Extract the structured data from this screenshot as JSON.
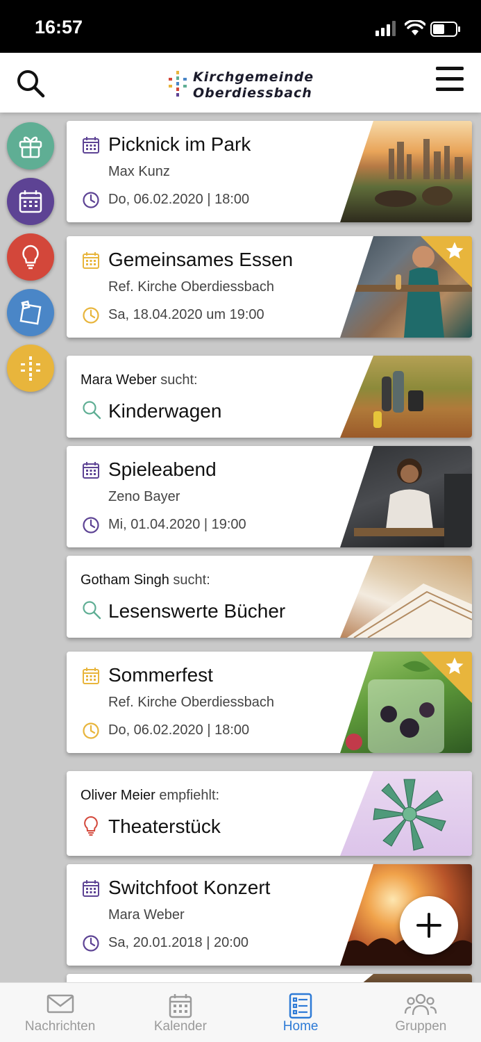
{
  "status_bar": {
    "time": "16:57"
  },
  "header": {
    "logo_line1": "Kirchgemeinde",
    "logo_line2": "Oberdiessbach"
  },
  "side_menu": [
    {
      "icon": "gift-icon",
      "color": "#5fae94"
    },
    {
      "icon": "calendar-icon",
      "color": "#5d4394"
    },
    {
      "icon": "lightbulb-icon",
      "color": "#d3473a"
    },
    {
      "icon": "note-icon",
      "color": "#4a86c7"
    },
    {
      "icon": "cross-icon",
      "color": "#e8b53c"
    }
  ],
  "feed": [
    {
      "type": "event",
      "title": "Picknick im Park",
      "subtitle": "Max Kunz",
      "datetime": "Do, 06.02.2020 | 18:00",
      "accent": "#5d4394",
      "featured": false
    },
    {
      "type": "event",
      "title": "Gemeinsames Essen",
      "subtitle": "Ref. Kirche Oberdiessbach",
      "datetime": "Sa, 18.04.2020 um 19:00",
      "accent": "#e8b53c",
      "featured": true
    },
    {
      "type": "search",
      "person": "Mara Weber",
      "verb": "sucht:",
      "title": "Kinderwagen",
      "accent": "#5fae94"
    },
    {
      "type": "event",
      "title": "Spieleabend",
      "subtitle": "Zeno Bayer",
      "datetime": "Mi, 01.04.2020 | 19:00",
      "accent": "#5d4394",
      "featured": false
    },
    {
      "type": "search",
      "person": "Gotham Singh",
      "verb": "sucht:",
      "title": "Lesenswerte Bücher",
      "accent": "#5fae94"
    },
    {
      "type": "event",
      "title": "Sommerfest",
      "subtitle": "Ref. Kirche Oberdiessbach",
      "datetime": "Do, 06.02.2020 | 18:00",
      "accent": "#e8b53c",
      "featured": true
    },
    {
      "type": "recommend",
      "person": "Oliver Meier",
      "verb": "empfiehlt:",
      "title": "Theaterstück",
      "accent": "#d3473a"
    },
    {
      "type": "event",
      "title": "Switchfoot Konzert",
      "subtitle": "Mara Weber",
      "datetime": "Sa, 20.01.2018 | 20:00",
      "accent": "#5d4394",
      "featured": false
    }
  ],
  "tabbar": {
    "tabs": [
      {
        "label": "Nachrichten",
        "icon": "envelope-icon",
        "active": false
      },
      {
        "label": "Kalender",
        "icon": "calendar-icon",
        "active": false
      },
      {
        "label": "Home",
        "icon": "list-icon",
        "active": true
      },
      {
        "label": "Gruppen",
        "icon": "people-icon",
        "active": false
      }
    ]
  }
}
